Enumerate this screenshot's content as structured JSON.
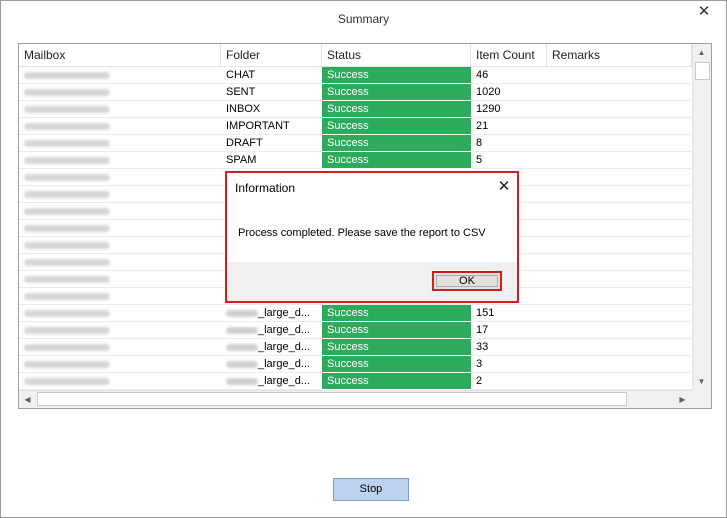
{
  "window": {
    "title": "Summary",
    "close_glyph": "✕"
  },
  "grid": {
    "columns": [
      "Mailbox",
      "Folder",
      "Status",
      "Item Count",
      "Remarks"
    ],
    "rows": [
      {
        "folder": "CHAT",
        "status": "Success",
        "count": "46"
      },
      {
        "folder": "SENT",
        "status": "Success",
        "count": "1020"
      },
      {
        "folder": "INBOX",
        "status": "Success",
        "count": "1290"
      },
      {
        "folder": "IMPORTANT",
        "status": "Success",
        "count": "21"
      },
      {
        "folder": "DRAFT",
        "status": "Success",
        "count": "8"
      },
      {
        "folder": "SPAM",
        "status": "Success",
        "count": "5"
      },
      {
        "folder": "",
        "status": "",
        "count": ""
      },
      {
        "folder": "",
        "status": "",
        "count": ""
      },
      {
        "folder": "",
        "status": "",
        "count": ""
      },
      {
        "folder": "",
        "status": "",
        "count": ""
      },
      {
        "folder": "",
        "status": "",
        "count": ""
      },
      {
        "folder": "",
        "status": "",
        "count": ""
      },
      {
        "folder": "",
        "status": "",
        "count": ""
      },
      {
        "folder": "",
        "status": "",
        "count": ""
      },
      {
        "folder": "_large_d...",
        "status": "Success",
        "count": "151"
      },
      {
        "folder": "_large_d...",
        "status": "Success",
        "count": "17"
      },
      {
        "folder": "_large_d...",
        "status": "Success",
        "count": "33"
      },
      {
        "folder": "_large_d...",
        "status": "Success",
        "count": "3"
      },
      {
        "folder": "_large_d...",
        "status": "Success",
        "count": "2"
      }
    ],
    "scroll": {
      "up": "▲",
      "down": "▼",
      "left": "◀",
      "right": "▶"
    }
  },
  "dialog": {
    "title": "Information",
    "message": "Process completed. Please save the report to CSV",
    "ok_label": "OK",
    "close_glyph": "✕"
  },
  "footer": {
    "stop_label": "Stop"
  },
  "colors": {
    "success": "#2eaa5c",
    "highlight": "#cc1f1f",
    "stop_button": "#bcd2ee"
  }
}
